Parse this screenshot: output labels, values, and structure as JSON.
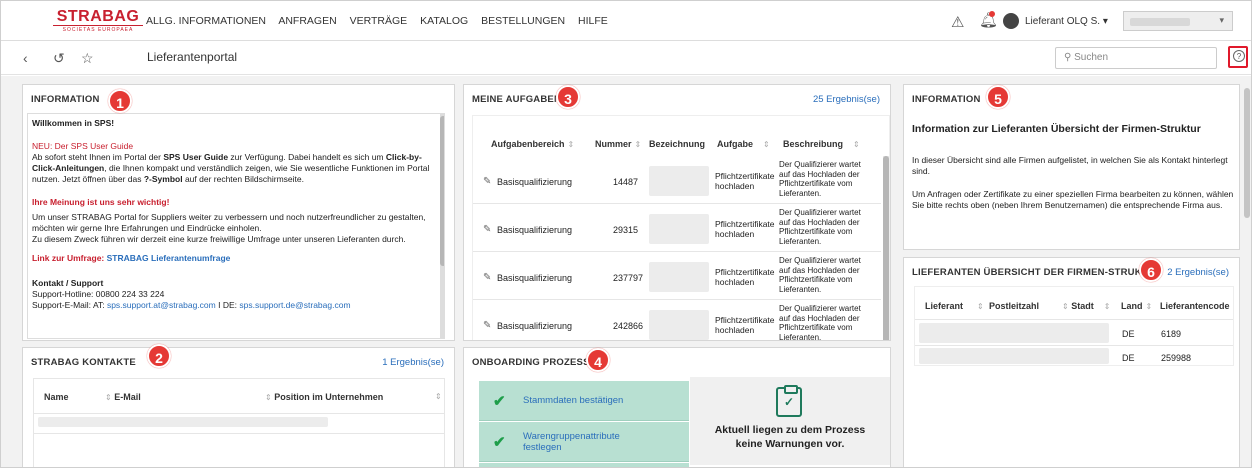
{
  "header": {
    "logo_main": "STRABAG",
    "logo_sub": "SOCIETAS EUROPAEA",
    "menu": [
      "ALLG. INFORMATIONEN",
      "ANFRAGEN",
      "VERTRÄGE",
      "KATALOG",
      "BESTELLUNGEN",
      "HILFE"
    ],
    "user_name": "Lieferant OLQ S. ▾"
  },
  "subheader": {
    "title": "Lieferantenportal",
    "search_placeholder": "Suchen"
  },
  "panel_info": {
    "title": "INFORMATION",
    "badge": "1",
    "welcome": "Willkommen in SPS!",
    "neu_heading": "NEU: Der SPS User Guide",
    "neu_text_1": "Ab sofort steht Ihnen im Portal der ",
    "neu_bold_1": "SPS User Guide",
    "neu_text_2": " zur Verfügung. Dabei handelt es sich um ",
    "neu_bold_2": "Click-by-Click-Anleitungen",
    "neu_text_3": ", die Ihnen kompakt und verständlich zeigen, wie Sie wesentliche Funktionen im Portal nutzen. Jetzt öffnen über das ",
    "neu_bold_3": "?-Symbol",
    "neu_text_4": " auf der rechten Bildschirmseite.",
    "meinung_heading": "Ihre Meinung ist uns sehr wichtig!",
    "meinung_text_1": "Um unser STRABAG Portal for Suppliers weiter zu verbessern und noch nutzerfreundlicher zu gestalten, möchten wir gerne Ihre Erfahrungen und Eindrücke einholen.",
    "meinung_text_2": "Zu diesem Zweck führen wir derzeit eine kurze freiwillige Umfrage unter unseren Lieferanten durch.",
    "umfrage_label": "Link zur Umfrage: ",
    "umfrage_link": "STRABAG Lieferantenumfrage",
    "kontakt_heading": "Kontakt / Support",
    "hotline": "Support-Hotline: 00800 224 33 224",
    "email_label": "Support-E-Mail: AT: ",
    "email_at": "sps.support.at@strabag.com",
    "email_sep": " I DE: ",
    "email_de": "sps.support.de@strabag.com"
  },
  "panel_kontakte": {
    "title": "STRABAG KONTAKTE",
    "badge": "2",
    "results": "1 Ergebnis(se)",
    "columns": [
      "Name",
      "E-Mail",
      "Position im Unternehmen"
    ]
  },
  "panel_aufgaben": {
    "title": "MEINE AUFGABEN",
    "badge": "3",
    "results": "25 Ergebnis(se)",
    "columns": [
      "Aufgabenbereich",
      "Nummer",
      "Bezeichnung",
      "Aufgabe",
      "Beschreibung"
    ],
    "rows": [
      {
        "bereich": "Basisqualifizierung",
        "nummer": "14487",
        "aufgabe_1": "Pflichtzertifikate",
        "aufgabe_2": "hochladen",
        "beschreibung": [
          "Der Qualifizierer wartet",
          "auf das Hochladen der",
          "Pflichtzertifikate vom",
          "Lieferanten."
        ]
      },
      {
        "bereich": "Basisqualifizierung",
        "nummer": "29315",
        "aufgabe_1": "Pflichtzertifikate",
        "aufgabe_2": "hochladen",
        "beschreibung": [
          "Der Qualifizierer wartet",
          "auf das Hochladen der",
          "Pflichtzertifikate vom",
          "Lieferanten."
        ]
      },
      {
        "bereich": "Basisqualifizierung",
        "nummer": "237797",
        "aufgabe_1": "Pflichtzertifikate",
        "aufgabe_2": "hochladen",
        "beschreibung": [
          "Der Qualifizierer wartet",
          "auf das Hochladen der",
          "Pflichtzertifikate vom",
          "Lieferanten."
        ]
      },
      {
        "bereich": "Basisqualifizierung",
        "nummer": "242866",
        "aufgabe_1": "Pflichtzertifikate",
        "aufgabe_2": "hochladen",
        "beschreibung": [
          "Der Qualifizierer wartet",
          "auf das Hochladen der",
          "Pflichtzertifikate vom",
          "Lieferanten."
        ]
      }
    ]
  },
  "panel_onboarding": {
    "title": "ONBOARDING PROZESS",
    "badge": "4",
    "steps": [
      {
        "label_1": "Stammdaten bestätigen",
        "label_2": ""
      },
      {
        "label_1": "Warengruppenattribute",
        "label_2": "festlegen"
      }
    ],
    "message_1": "Aktuell liegen zu dem Prozess",
    "message_2": "keine Warnungen vor."
  },
  "panel_info2": {
    "title": "INFORMATION",
    "badge": "5",
    "heading": "Information zur Lieferanten Übersicht der Firmen-Struktur",
    "text_1": "In dieser Übersicht sind alle Firmen aufgelistet, in welchen Sie als Kontakt hinterlegt sind.",
    "text_2": "Um Anfragen oder Zertifikate zu einer speziellen Firma bearbeiten zu können, wählen Sie bitte rechts oben (neben Ihrem Benutzernamen) die entsprechende Firma aus."
  },
  "panel_struktur": {
    "title": "LIEFERANTEN ÜBERSICHT DER FIRMEN-STRUKTUR",
    "badge": "6",
    "results": "2 Ergebnis(se)",
    "columns": [
      "Lieferant",
      "Postleitzahl",
      "Stadt",
      "Land",
      "Lieferantencode"
    ],
    "rows": [
      {
        "land": "DE",
        "code": "6189"
      },
      {
        "land": "DE",
        "code": "259988"
      }
    ]
  },
  "colors": {
    "brand_red": "#c8202f",
    "link_blue": "#2a6ebb",
    "step_green": "#b8e0d2",
    "check_green": "#1e9e4a"
  }
}
